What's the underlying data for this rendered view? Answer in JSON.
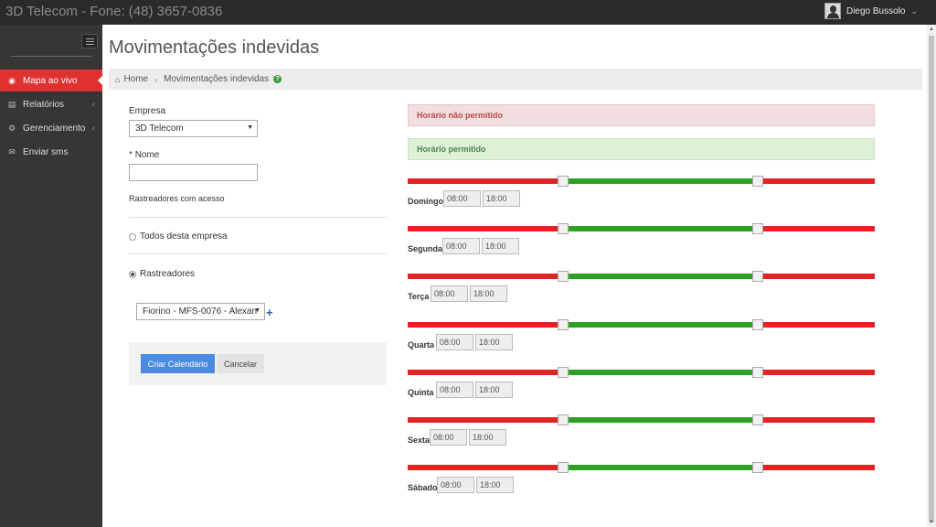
{
  "topbar": {
    "brand": "3D Telecom - Fone: (48) 3657-0836",
    "user_name": "Diego Bussolo",
    "user_menu_icon": "chevron-down-icon"
  },
  "sidebar": {
    "items": [
      {
        "label": "Mapa ao vivo",
        "icon": "globe-icon",
        "active": true
      },
      {
        "label": "Relatórios",
        "icon": "book-icon",
        "arrow": "‹"
      },
      {
        "label": "Gerenciamento",
        "icon": "gears-icon",
        "arrow": "‹"
      },
      {
        "label": "Enviar sms",
        "icon": "envelope-icon"
      }
    ]
  },
  "page": {
    "title": "Movimentações indevidas"
  },
  "breadcrumb": {
    "home": "Home",
    "current": "Movimentações indevidas",
    "help": "?"
  },
  "form": {
    "empresa_label": "Empresa",
    "empresa_value": "3D Telecom",
    "nome_required": "*",
    "nome_label": "Nome",
    "nome_value": "",
    "rastreadores_acesso_label": "Rastreadores com acesso",
    "option_todos": "Todos desta empresa",
    "option_rastreadores": "Rastreadores",
    "rastreador_selected": "Fiorino - MFS-0076 - Alexan",
    "add_symbol": "+",
    "submit_label": "Criar Calendário",
    "cancel_label": "Cancelar"
  },
  "legend": {
    "not_allowed": "Horário não permitido",
    "allowed": "Horário permitido"
  },
  "schedule": {
    "days": [
      {
        "name": "Domingo",
        "start": "08:00",
        "end": "18:00"
      },
      {
        "name": "Segunda",
        "start": "08:00",
        "end": "18:00"
      },
      {
        "name": "Terça",
        "start": "08:00",
        "end": "18:00"
      },
      {
        "name": "Quarta",
        "start": "08:00",
        "end": "18:00"
      },
      {
        "name": "Quinta",
        "start": "08:00",
        "end": "18:00"
      },
      {
        "name": "Sexta",
        "start": "08:00",
        "end": "18:00"
      },
      {
        "name": "Sábado",
        "start": "08:00",
        "end": "18:00"
      }
    ],
    "range_start_fraction": 0.3333,
    "range_end_fraction": 0.75,
    "colors": {
      "not_allowed": "#e02424",
      "allowed": "#2ea024"
    }
  }
}
